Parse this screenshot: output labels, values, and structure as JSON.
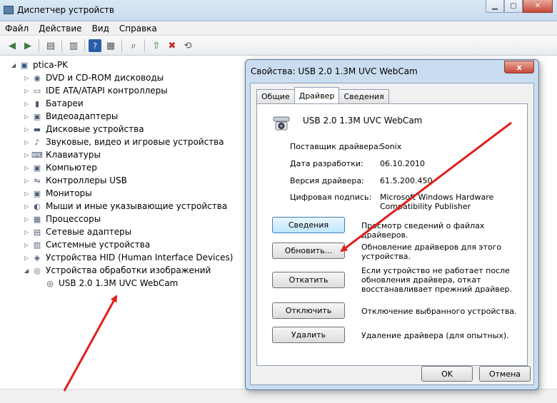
{
  "window": {
    "title": "Диспетчер устройств"
  },
  "menu": [
    "Файл",
    "Действие",
    "Вид",
    "Справка"
  ],
  "toolbar": {
    "icons": [
      "back-icon",
      "forward-icon",
      "properties-icon",
      "show-icon",
      "help-icon",
      "view-icon",
      "scan-icon",
      "update-driver-icon",
      "disable-icon",
      "uninstall-icon"
    ]
  },
  "tree": {
    "root": "ptica-PK",
    "categories": [
      {
        "label": "DVD и CD-ROM дисководы",
        "icon": "dvd-drive-icon",
        "glyph": "◉"
      },
      {
        "label": "IDE ATA/ATAPI контроллеры",
        "icon": "ide-controller-icon",
        "glyph": "▭"
      },
      {
        "label": "Батареи",
        "icon": "battery-icon",
        "glyph": "▮"
      },
      {
        "label": "Видеоадаптеры",
        "icon": "display-adapter-icon",
        "glyph": "▣"
      },
      {
        "label": "Дисковые устройства",
        "icon": "disk-drive-icon",
        "glyph": "▬"
      },
      {
        "label": "Звуковые, видео и игровые устройства",
        "icon": "sound-icon",
        "glyph": "♪"
      },
      {
        "label": "Клавиатуры",
        "icon": "keyboard-icon",
        "glyph": "⌨"
      },
      {
        "label": "Компьютер",
        "icon": "computer-icon",
        "glyph": "▣"
      },
      {
        "label": "Контроллеры USB",
        "icon": "usb-icon",
        "glyph": "⇋"
      },
      {
        "label": "Мониторы",
        "icon": "monitor-icon",
        "glyph": "▣"
      },
      {
        "label": "Мыши и иные указывающие устройства",
        "icon": "mouse-icon",
        "glyph": "◐"
      },
      {
        "label": "Процессоры",
        "icon": "processor-icon",
        "glyph": "▦"
      },
      {
        "label": "Сетевые адаптеры",
        "icon": "network-adapter-icon",
        "glyph": "▤"
      },
      {
        "label": "Системные устройства",
        "icon": "system-device-icon",
        "glyph": "▥"
      },
      {
        "label": "Устройства HID (Human Interface Devices)",
        "icon": "hid-icon",
        "glyph": "◈"
      },
      {
        "label": "Устройства обработки изображений",
        "icon": "imaging-device-icon",
        "glyph": "◎"
      }
    ],
    "child": "USB 2.0 1.3M UVC WebCam"
  },
  "dialog": {
    "title": "Свойства: USB 2.0 1.3M UVC WebCam",
    "close": "x",
    "tabs": [
      "Общие",
      "Драйвер",
      "Сведения"
    ],
    "device_name": "USB 2.0 1.3M UVC WebCam",
    "props": [
      {
        "key": "Поставщик драйвера:",
        "value": "Sonix"
      },
      {
        "key": "Дата разработки:",
        "value": "06.10.2010"
      },
      {
        "key": "Версия драйвера:",
        "value": "61.5.200.450"
      },
      {
        "key": "Цифровая подпись:",
        "value": "Microsoft Windows Hardware Compatibility Publisher"
      }
    ],
    "actions": [
      {
        "label": "Сведения",
        "desc": "Просмотр сведений о файлах драйверов."
      },
      {
        "label": "Обновить...",
        "desc": "Обновление драйверов для этого устройства."
      },
      {
        "label": "Откатить",
        "desc": "Если устройство не работает после обновления драйвера, откат восстанавливает прежний драйвер."
      },
      {
        "label": "Отключить",
        "desc": "Отключение выбранного устройства."
      },
      {
        "label": "Удалить",
        "desc": "Удаление драйвера (для опытных)."
      }
    ],
    "ok": "OK",
    "cancel": "Отмена"
  },
  "colors": {
    "arrow": "#e0201c",
    "dialog_frame": "#c9dcf0"
  }
}
